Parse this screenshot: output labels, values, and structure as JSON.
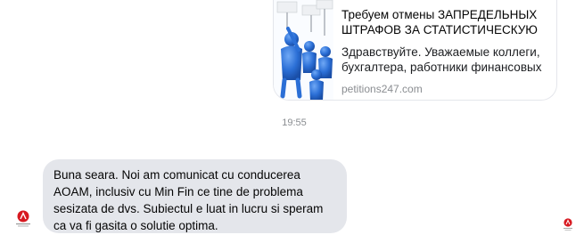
{
  "link_preview": {
    "title": "Требуем отмены ЗАПРЕДЕЛЬНЫХ ШТРАФОВ ЗА СТАТИСТИЧЕСКУЮ",
    "description": "Здравствуйте. Уважаемые коллеги, бухгалтера, работники финансовых",
    "domain": "petitions247.com",
    "thumbnail_icon": "protest-figures-image"
  },
  "timestamp": "19:55",
  "incoming_message": {
    "text": "Buna seara. Noi am comunicat cu conducerea\nAOAM, inclusiv cu Min Fin ce tine de problema\nsesizata de dvs. Subiectul e luat in lucru si speram\nca va fi gasita o solutie optima.",
    "avatar_icon": "organization-logo-icon"
  },
  "read_receipt": {
    "icon": "read-receipt-avatar-icon"
  },
  "colors": {
    "bubble_bg": "#e4e6eb",
    "brand_red": "#d71920",
    "figure_blue": "#2b6fd6"
  }
}
